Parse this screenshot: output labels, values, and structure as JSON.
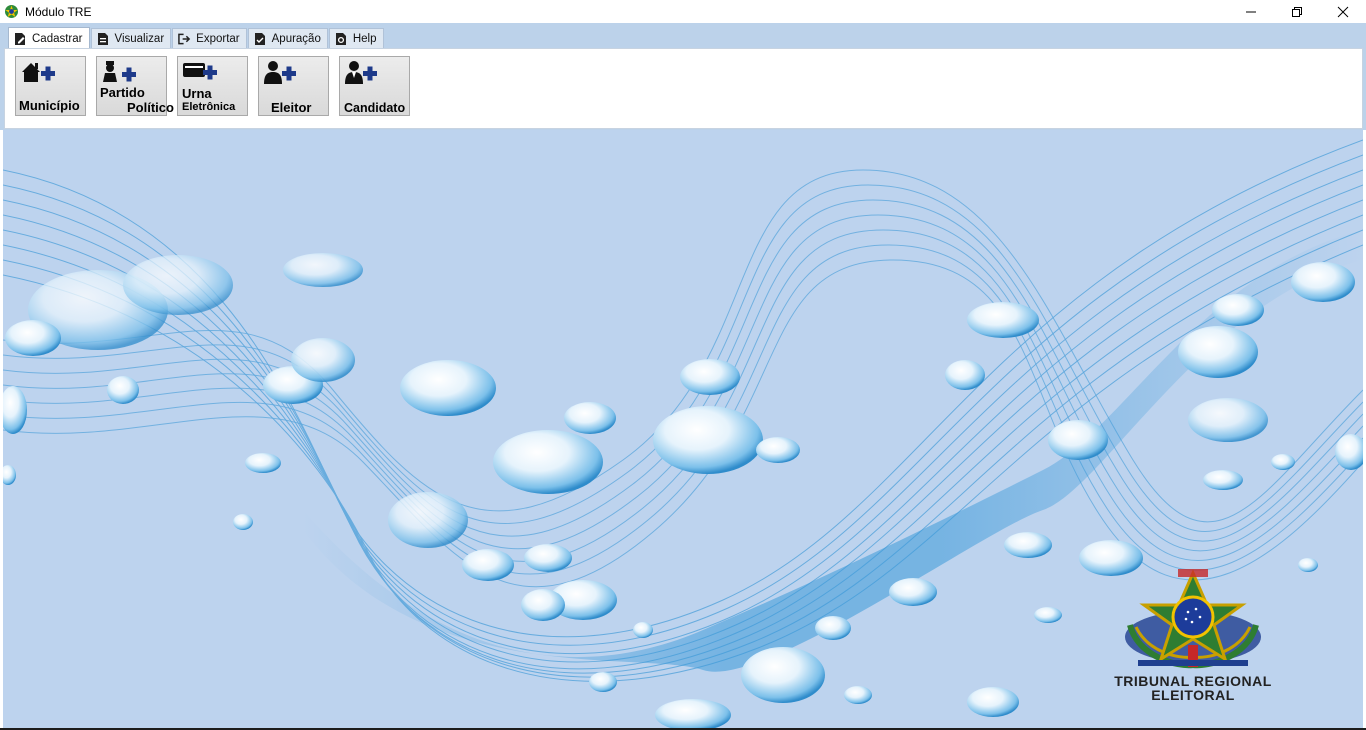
{
  "window": {
    "title": "Módulo TRE",
    "app_icon": "brazil-coat-of-arms-icon",
    "controls": {
      "minimize": "—",
      "restore": "❐",
      "close": "✕"
    }
  },
  "tabs": [
    {
      "label": "Cadastrar",
      "icon": "document-edit-icon",
      "active": true
    },
    {
      "label": "Visualizar",
      "icon": "document-view-icon",
      "active": false
    },
    {
      "label": "Exportar",
      "icon": "export-icon",
      "active": false
    },
    {
      "label": "Apuração",
      "icon": "document-check-icon",
      "active": false
    },
    {
      "label": "Help",
      "icon": "help-icon",
      "active": false
    }
  ],
  "toolbar": {
    "municipio": {
      "label": "Município",
      "icon": "house-add-icon"
    },
    "partido": {
      "line1": "Partido",
      "line2": "Político",
      "icon": "politician-add-icon"
    },
    "urna": {
      "line1": "Urna",
      "line2": "Eletrônica",
      "icon": "ballot-box-add-icon"
    },
    "eleitor": {
      "label": "Eleitor",
      "icon": "voter-add-icon"
    },
    "candidato": {
      "label": "Candidato",
      "icon": "candidate-add-icon"
    }
  },
  "logo": {
    "line1": "TRIBUNAL REGIONAL",
    "line2": "ELEITORAL"
  },
  "colors": {
    "background": "#bdd3ee",
    "wave": "#5aa6dc",
    "plus_icon": "#1e3a8a"
  }
}
